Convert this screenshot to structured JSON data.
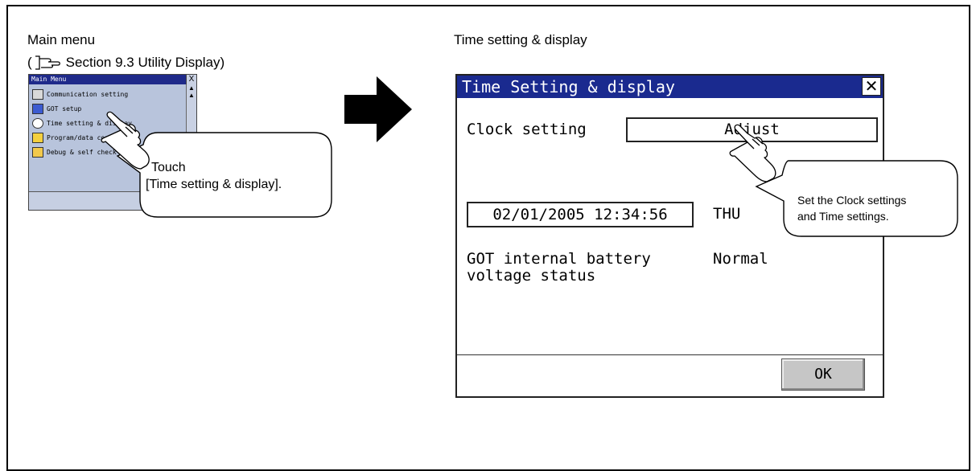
{
  "left_panel": {
    "heading": "Main menu",
    "ref_open": "(",
    "ref_text": "Section 9.3 Utility Display)"
  },
  "main_menu": {
    "title": "Main Menu",
    "close": "X",
    "items": [
      {
        "label": "Communication setting",
        "icon": "communication-icon"
      },
      {
        "label": "GOT setup",
        "icon": "got-setup-icon"
      },
      {
        "label": "Time setting & display",
        "icon": "clock-icon"
      },
      {
        "label": "Program/data control",
        "icon": "folder-icon"
      },
      {
        "label": "Debug & self check",
        "icon": "debug-icon"
      }
    ]
  },
  "callout_left": {
    "line1": "Touch",
    "line2": "[Time setting & display]."
  },
  "right_panel": {
    "heading": "Time setting & display"
  },
  "dialog": {
    "title": "Time Setting & display",
    "close": "✕",
    "clock_setting_label": "Clock setting",
    "adjust_button": "Adjust",
    "datetime": "02/01/2005 12:34:56",
    "weekday": "THU",
    "battery_label_line1": "GOT internal battery",
    "battery_label_line2": "voltage status",
    "battery_status": "Normal",
    "ok_button": "OK"
  },
  "callout_right": {
    "line1": "Set the Clock settings",
    "line2": "and Time settings."
  },
  "colors": {
    "title_bar": "#1a2a8f",
    "thumb_background": "#b8c4dc",
    "ok_button": "#c6c6c6"
  }
}
